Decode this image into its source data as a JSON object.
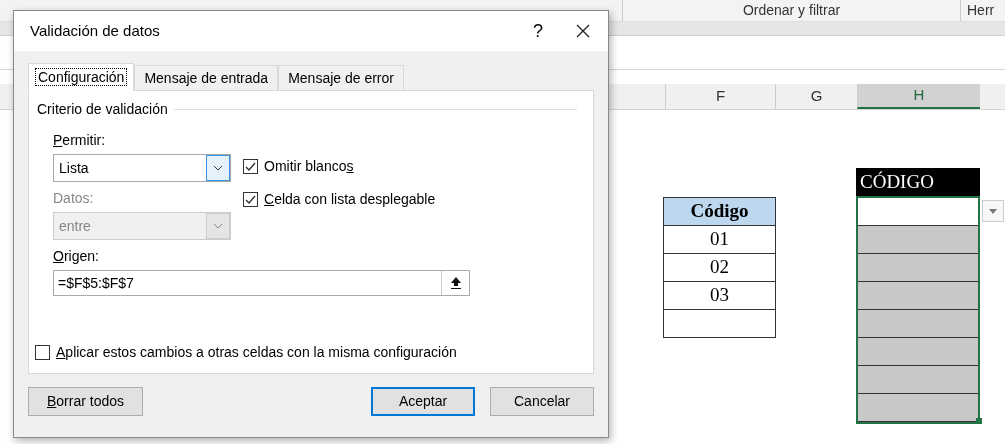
{
  "ribbon_groups": [
    {
      "label": "Ordenar y filtrar"
    },
    {
      "label": "Herr"
    }
  ],
  "columns": [
    {
      "label": "F",
      "selected": false
    },
    {
      "label": "G",
      "selected": false
    },
    {
      "label": "H",
      "selected": true
    }
  ],
  "lookup_table": {
    "header": "Código",
    "rows": [
      "01",
      "02",
      "03"
    ]
  },
  "target_range": {
    "header": "CÓDIGO"
  },
  "dialog": {
    "title": "Validación de datos",
    "help": "?",
    "tabs": [
      {
        "label": "Configuración",
        "selected": true
      },
      {
        "label": "Mensaje de entrada",
        "selected": false
      },
      {
        "label": "Mensaje de error",
        "selected": false
      }
    ],
    "section": "Criterio de validación",
    "allow": {
      "label": {
        "key": "P",
        "post": "ermitir:"
      },
      "value": "Lista",
      "disabled": false
    },
    "data": {
      "label": {
        "pre": "Datos:"
      },
      "value": "entre",
      "disabled": true
    },
    "checkboxes": [
      {
        "label": {
          "pre": "Omitir blanco",
          "key": "s"
        },
        "checked": true
      },
      {
        "label": {
          "key": "C",
          "post": "elda con lista desplegable"
        },
        "checked": true
      }
    ],
    "origin": {
      "label": {
        "key": "O",
        "post": "rigen:"
      },
      "value": "=$F$5:$F$7"
    },
    "apply_all": {
      "label": {
        "key": "A",
        "post": "plicar estos cambios a otras celdas con la misma configuración"
      },
      "checked": false
    },
    "buttons": [
      {
        "label": {
          "key": "B",
          "post": "orrar todos"
        },
        "default": false
      },
      {
        "label": {
          "pre": "Aceptar"
        },
        "default": true
      },
      {
        "label": {
          "pre": "Cancelar"
        },
        "default": false
      }
    ]
  }
}
